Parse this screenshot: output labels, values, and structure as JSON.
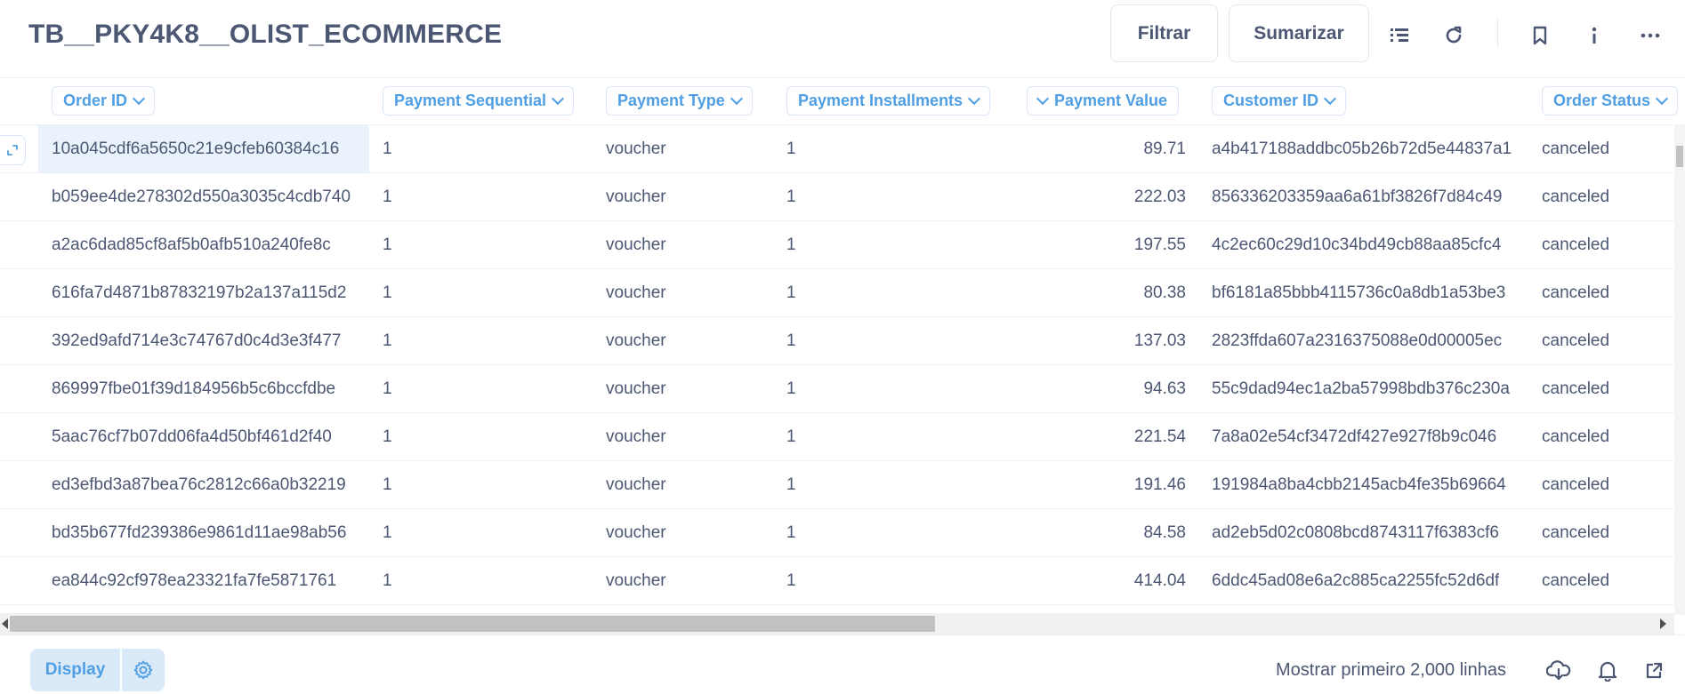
{
  "header": {
    "title": "TB__PKY4K8__OLIST_ECOMMERCE",
    "filter_label": "Filtrar",
    "summarize_label": "Sumarizar"
  },
  "table": {
    "columns": [
      "Order ID",
      "Payment Sequential",
      "Payment Type",
      "Payment Installments",
      "Payment Value",
      "Customer ID",
      "Order Status"
    ],
    "rows": [
      [
        "10a045cdf6a5650c21e9cfeb60384c16",
        "1",
        "voucher",
        "1",
        "89.71",
        "a4b417188addbc05b26b72d5e44837a1",
        "canceled"
      ],
      [
        "b059ee4de278302d550a3035c4cdb740",
        "1",
        "voucher",
        "1",
        "222.03",
        "856336203359aa6a61bf3826f7d84c49",
        "canceled"
      ],
      [
        "a2ac6dad85cf8af5b0afb510a240fe8c",
        "1",
        "voucher",
        "1",
        "197.55",
        "4c2ec60c29d10c34bd49cb88aa85cfc4",
        "canceled"
      ],
      [
        "616fa7d4871b87832197b2a137a115d2",
        "1",
        "voucher",
        "1",
        "80.38",
        "bf6181a85bbb4115736c0a8db1a53be3",
        "canceled"
      ],
      [
        "392ed9afd714e3c74767d0c4d3e3f477",
        "1",
        "voucher",
        "1",
        "137.03",
        "2823ffda607a2316375088e0d00005ec",
        "canceled"
      ],
      [
        "869997fbe01f39d184956b5c6bccfdbe",
        "1",
        "voucher",
        "1",
        "94.63",
        "55c9dad94ec1a2ba57998bdb376c230a",
        "canceled"
      ],
      [
        "5aac76cf7b07dd06fa4d50bf461d2f40",
        "1",
        "voucher",
        "1",
        "221.54",
        "7a8a02e54cf3472df427e927f8b9c046",
        "canceled"
      ],
      [
        "ed3efbd3a87bea76c2812c66a0b32219",
        "1",
        "voucher",
        "1",
        "191.46",
        "191984a8ba4cbb2145acb4fe35b69664",
        "canceled"
      ],
      [
        "bd35b677fd239386e9861d11ae98ab56",
        "1",
        "voucher",
        "1",
        "84.58",
        "ad2eb5d02c0808bcd8743117f6383cf6",
        "canceled"
      ],
      [
        "ea844c92cf978ea23321fa7fe5871761",
        "1",
        "voucher",
        "1",
        "414.04",
        "6ddc45ad08e6a2c885ca2255fc52d6df",
        "canceled"
      ]
    ]
  },
  "footer": {
    "display_label": "Display",
    "rows_note": "Mostrar primeiro 2,000 linhas"
  },
  "colors": {
    "accent": "#509ee3",
    "text": "#4c5773",
    "selected_cell": "#eaf3fc"
  }
}
